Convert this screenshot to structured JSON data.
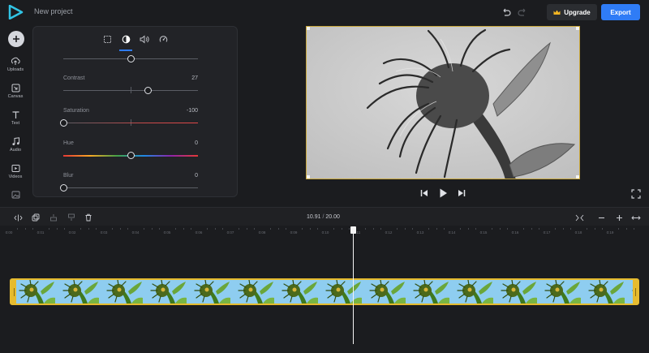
{
  "app": {
    "project_title": "New project",
    "upgrade_label": "Upgrade",
    "export_label": "Export",
    "accent_color": "#2f7cf6",
    "logo_color": "#31c4e5"
  },
  "sidebar": {
    "items": [
      {
        "label": "Uploads",
        "icon": "upload-icon"
      },
      {
        "label": "Canvas",
        "icon": "canvas-icon"
      },
      {
        "label": "Text",
        "icon": "text-icon"
      },
      {
        "label": "Audio",
        "icon": "audio-icon"
      },
      {
        "label": "Videos",
        "icon": "video-icon"
      },
      {
        "label": "",
        "icon": "image-icon"
      }
    ]
  },
  "panel": {
    "tabs": [
      "crop-icon",
      "adjust-icon",
      "volume-icon",
      "speed-icon"
    ],
    "active_tab": 1,
    "adjustments": [
      {
        "label": "",
        "value": "",
        "fraction": 0.5
      },
      {
        "label": "Contrast",
        "value": "27",
        "fraction": 0.63
      },
      {
        "label": "Saturation",
        "value": "-100",
        "fraction": 0.0
      },
      {
        "label": "Hue",
        "value": "0",
        "fraction": 0.5
      },
      {
        "label": "Blur",
        "value": "0",
        "fraction": 0.0
      }
    ]
  },
  "timeline": {
    "current_time": "10.91",
    "separator": "/",
    "total_time": "20.00",
    "ruler_ticks": [
      "0:00",
      "0:01",
      "0:02",
      "0:03",
      "0:04",
      "0:05",
      "0:06",
      "0:07",
      "0:08",
      "0:09",
      "0:10",
      "0:11",
      "0:12",
      "0:13",
      "0:14",
      "0:15",
      "0:16",
      "0:17",
      "0:18",
      "0:19"
    ],
    "playhead_fraction": 0.5455,
    "clip_color": "#e6bb2e"
  }
}
